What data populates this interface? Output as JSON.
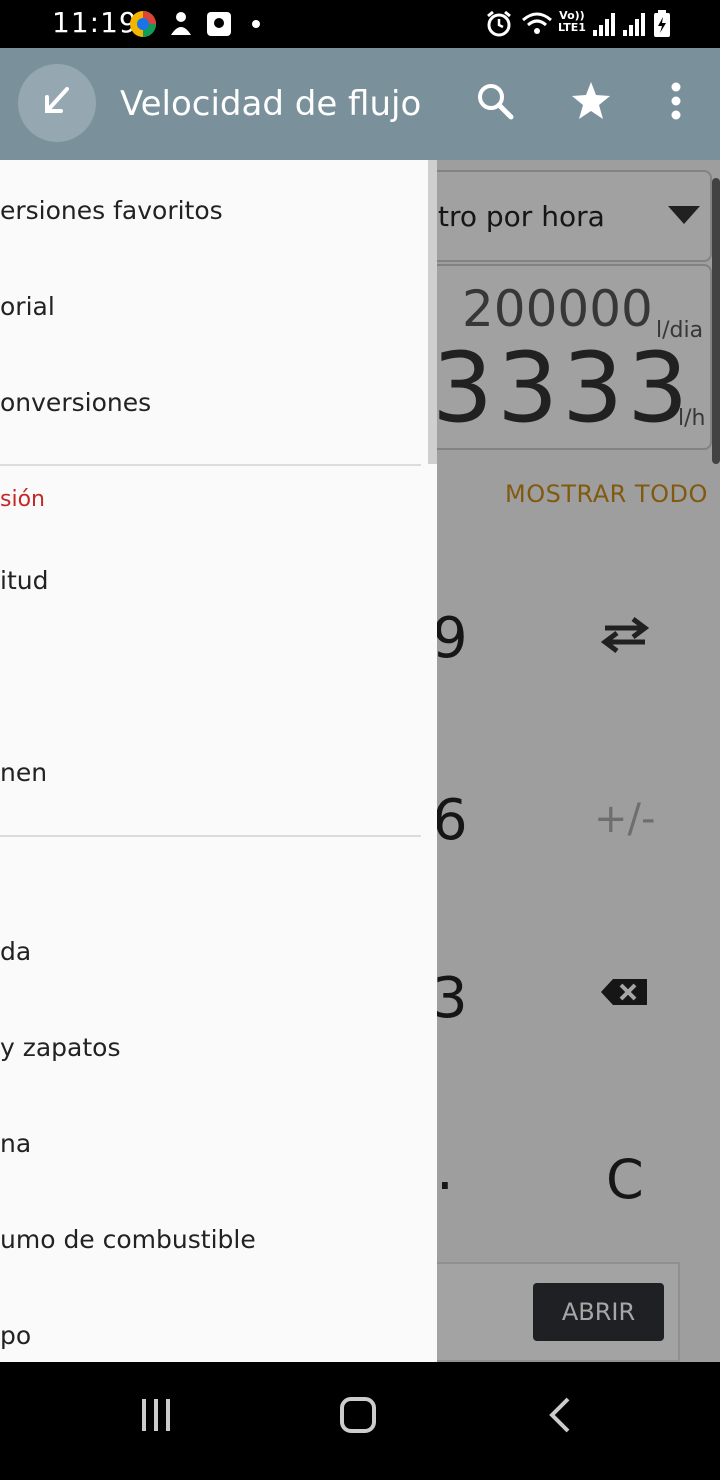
{
  "status_bar": {
    "time": "11:19",
    "volte_label": "Vo))",
    "lte_label": "LTE1"
  },
  "app_bar": {
    "title": "Velocidad de flujo",
    "icons": [
      "back-arrow-icon",
      "search-icon",
      "star-icon",
      "overflow-menu-icon"
    ]
  },
  "converter": {
    "unit_selected": "tro por hora",
    "value_primary": "200000",
    "unit_primary": "l/dia",
    "value_secondary": "3333",
    "unit_secondary": "l/h",
    "show_all_label": "MOSTRAR TODO"
  },
  "keypad": {
    "k9": "9",
    "k6": "6",
    "k3": "3",
    "kdot": ".",
    "plus_minus": "+/-",
    "clear": "C"
  },
  "ad": {
    "open_label": "ABRIR"
  },
  "drawer": {
    "items_top": [
      "ersiones favoritos",
      "orial",
      "onversiones"
    ],
    "section_label": "sión",
    "items_mid": [
      "itud",
      "nen"
    ],
    "items_bottom": [
      "da",
      " y zapatos",
      "na",
      "umo de combustible",
      "po"
    ]
  },
  "colors": {
    "app_bar": "#7a919c",
    "accent_orange": "#c68a18",
    "section_red": "#c62828"
  }
}
